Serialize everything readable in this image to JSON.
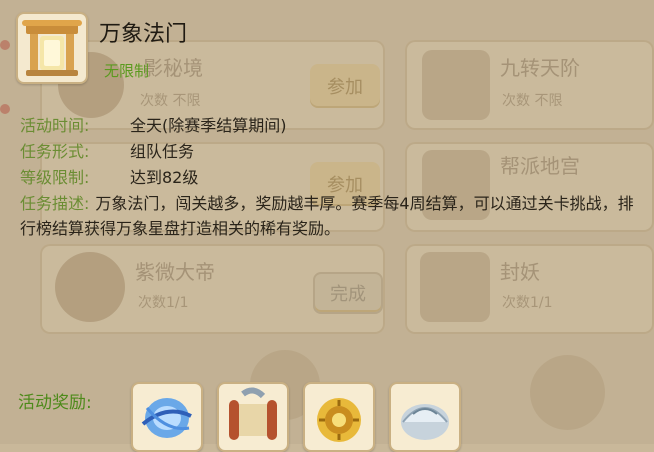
{
  "background": {
    "list_items": [
      {
        "name": "影秘境",
        "sub": "次数 不限"
      },
      {
        "name": "九转天阶",
        "sub": "次数 不限"
      },
      {
        "name": "帮派地宫",
        "sub": ""
      },
      {
        "name": "紫微大帝",
        "sub": "次数1/1"
      },
      {
        "name": "封妖",
        "sub": "次数1/1"
      }
    ],
    "join_label": "参加",
    "done_label": "完成"
  },
  "tooltip": {
    "title": "万象法门",
    "limit": "无限制",
    "time_label": "活动时间:",
    "time_value": "全天(除赛季结算期间)",
    "form_label": "任务形式:",
    "form_value": "组队任务",
    "level_label": "等级限制:",
    "level_value": "达到82级",
    "desc_label": "任务描述:",
    "desc_value": "万象法门，闯关越多，奖励越丰厚。赛季每4周结算，可以通过关卡挑战，排行榜结算获得万象星盘打造相关的稀有奖励。",
    "reward_label": "活动奖励:",
    "rewards": [
      {
        "icon": "blue-orb-icon"
      },
      {
        "icon": "scroll-icon"
      },
      {
        "icon": "sun-coin-icon"
      },
      {
        "icon": "silver-shell-icon"
      }
    ]
  }
}
